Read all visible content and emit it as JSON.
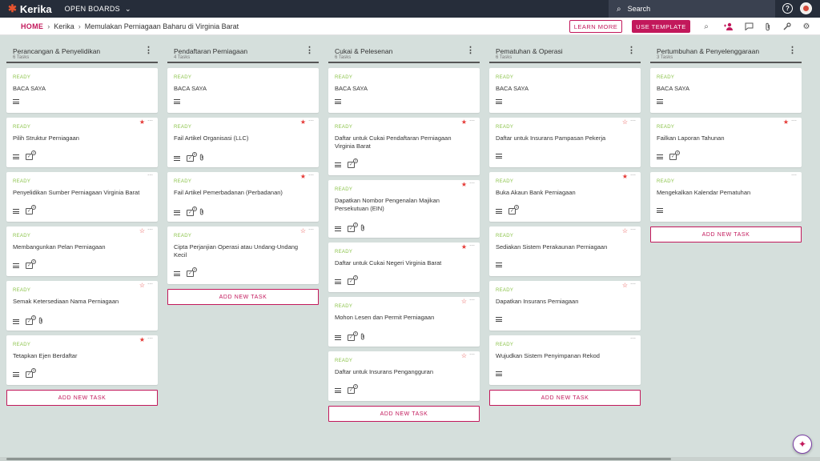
{
  "app": {
    "name": "Kerika"
  },
  "topbar": {
    "open_boards": "OPEN BOARDS",
    "search_placeholder": "Search"
  },
  "breadcrumb": {
    "home": "HOME",
    "org": "Kerika",
    "board": "Memulakan Perniagaan Baharu di Virginia Barat"
  },
  "actions": {
    "learn_more": "LEARN MORE",
    "use_template": "USE TEMPLATE"
  },
  "add_task_label": "ADD NEW TASK",
  "columns": [
    {
      "title": "Perancangan & Penyelidikan",
      "count": "6 Tasks",
      "cards": [
        {
          "status": "READY",
          "title": "BACA SAYA",
          "star": "none",
          "check": null,
          "clip": false
        },
        {
          "status": "READY",
          "title": "Pilih Struktur Perniagaan",
          "star": "filled",
          "check": "4",
          "clip": false
        },
        {
          "status": "READY",
          "title": "Penyelidikan Sumber Perniagaan Virginia Barat",
          "star": "none",
          "check": "3",
          "clip": false
        },
        {
          "status": "READY",
          "title": "Membangunkan Pelan Perniagaan",
          "star": "outline",
          "check": "4",
          "clip": false
        },
        {
          "status": "READY",
          "title": "Semak Ketersediaan Nama Perniagaan",
          "star": "outline",
          "check": "3",
          "clip": true
        },
        {
          "status": "READY",
          "title": "Tetapkan Ejen Berdaftar",
          "star": "filled",
          "check": "3",
          "clip": false
        }
      ]
    },
    {
      "title": "Pendaftaran Perniagaan",
      "count": "4 Tasks",
      "cards": [
        {
          "status": "READY",
          "title": "BACA SAYA",
          "star": "none",
          "check": null,
          "clip": false
        },
        {
          "status": "READY",
          "title": "Fail Artikel Organisasi (LLC)",
          "star": "filled",
          "check": "5",
          "clip": true
        },
        {
          "status": "READY",
          "title": "Fail Artikel Pemerbadanan (Perbadanan)",
          "star": "filled",
          "check": "5",
          "clip": true
        },
        {
          "status": "READY",
          "title": "Cipta Perjanjian Operasi atau Undang-Undang Kecil",
          "star": "outline",
          "check": "4",
          "clip": false
        }
      ]
    },
    {
      "title": "Cukai & Pelesenan",
      "count": "6 Tasks",
      "cards": [
        {
          "status": "READY",
          "title": "BACA SAYA",
          "star": "none",
          "check": null,
          "clip": false
        },
        {
          "status": "READY",
          "title": "Daftar untuk Cukai Pendaftaran Perniagaan Virginia Barat",
          "star": "filled",
          "check": "3",
          "clip": false
        },
        {
          "status": "READY",
          "title": "Dapatkan Nombor Pengenalan Majikan Persekutuan (EIN)",
          "star": "filled",
          "check": "3",
          "clip": true
        },
        {
          "status": "READY",
          "title": "Daftar untuk Cukai Negeri Virginia Barat",
          "star": "filled",
          "check": "3",
          "clip": false
        },
        {
          "status": "READY",
          "title": "Mohon Lesen dan Permit Perniagaan",
          "star": "outline",
          "check": "5",
          "clip": true
        },
        {
          "status": "READY",
          "title": "Daftar untuk Insurans Pengangguran",
          "star": "outline",
          "check": "4",
          "clip": false
        }
      ]
    },
    {
      "title": "Pematuhan & Operasi",
      "count": "6 Tasks",
      "cards": [
        {
          "status": "READY",
          "title": "BACA SAYA",
          "star": "none",
          "check": null,
          "clip": false
        },
        {
          "status": "READY",
          "title": "Daftar untuk Insurans Pampasan Pekerja",
          "star": "outline",
          "check": null,
          "clip": false
        },
        {
          "status": "READY",
          "title": "Buka Akaun Bank Perniagaan",
          "star": "filled",
          "check": "4",
          "clip": false
        },
        {
          "status": "READY",
          "title": "Sediakan Sistem Perakaunan Perniagaan",
          "star": "outline",
          "check": null,
          "clip": false
        },
        {
          "status": "READY",
          "title": "Dapatkan Insurans Perniagaan",
          "star": "outline",
          "check": null,
          "clip": false
        },
        {
          "status": "READY",
          "title": "Wujudkan Sistem Penyimpanan Rekod",
          "star": "none",
          "check": null,
          "clip": false
        }
      ]
    },
    {
      "title": "Pertumbuhan & Penyelenggaraan",
      "count": "3 Tasks",
      "cards": [
        {
          "status": "READY",
          "title": "BACA SAYA",
          "star": "none",
          "check": null,
          "clip": false
        },
        {
          "status": "READY",
          "title": "Failkan Laporan Tahunan",
          "star": "filled",
          "check": "4",
          "clip": false
        },
        {
          "status": "READY",
          "title": "Mengekalkan Kalendar Pematuhan",
          "star": "none",
          "check": null,
          "clip": false
        }
      ]
    }
  ],
  "colors": {
    "accent": "#c2185b",
    "status_ready": "#8bc34a",
    "star": "#e53935",
    "topbar": "#262d3a",
    "board_bg": "#d5dfdc"
  }
}
